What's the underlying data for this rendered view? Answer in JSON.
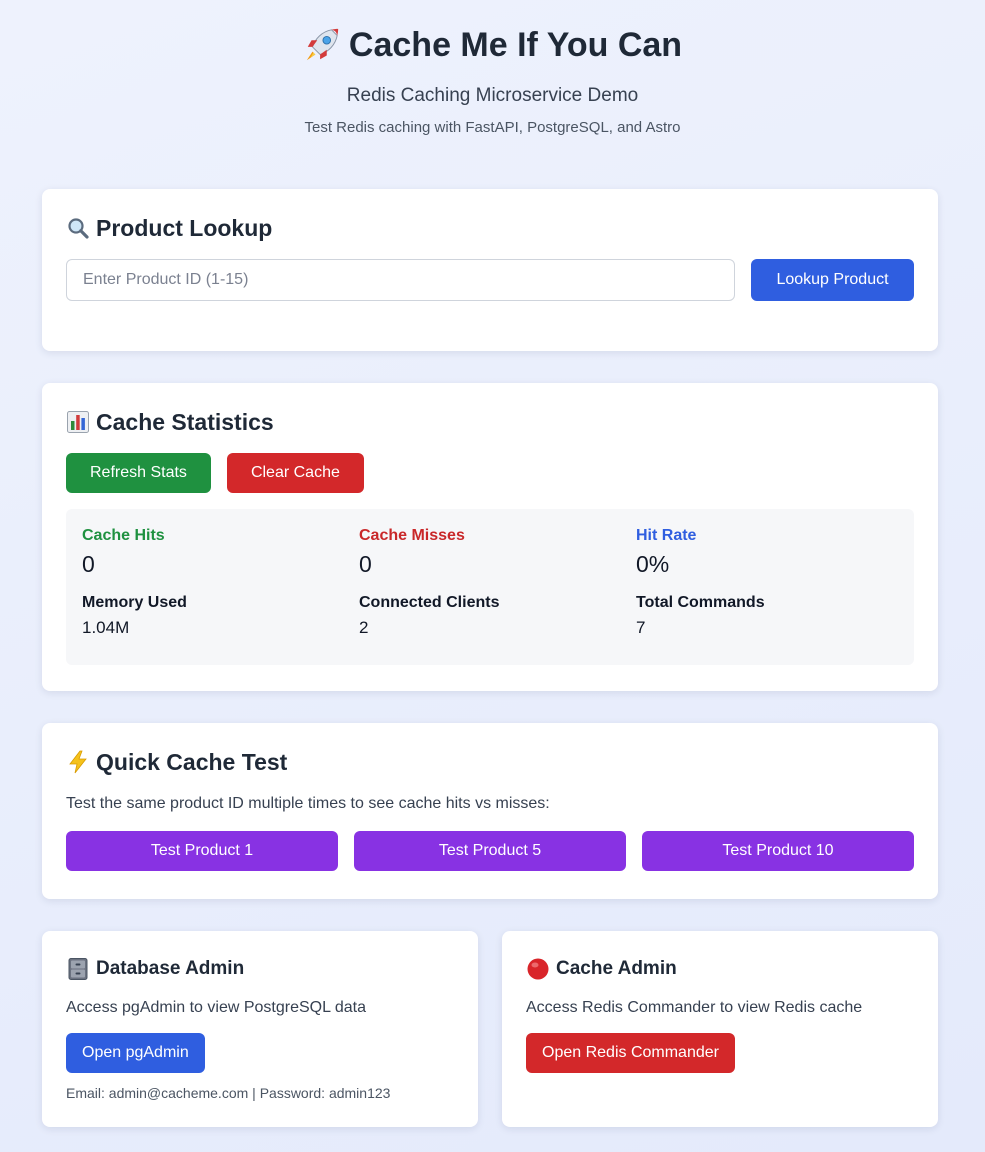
{
  "header": {
    "title": "Cache Me If You Can",
    "subtitle": "Redis Caching Microservice Demo",
    "tagline": "Test Redis caching with FastAPI, PostgreSQL, and Astro",
    "icon": "rocket-icon"
  },
  "lookup": {
    "heading": "Product Lookup",
    "icon": "magnifier-icon",
    "placeholder": "Enter Product ID (1-15)",
    "value": "",
    "button_label": "Lookup Product"
  },
  "stats": {
    "heading": "Cache Statistics",
    "icon": "bar-chart-icon",
    "refresh_label": "Refresh Stats",
    "clear_label": "Clear Cache",
    "hits_label": "Cache Hits",
    "hits_value": "0",
    "misses_label": "Cache Misses",
    "misses_value": "0",
    "hit_rate_label": "Hit Rate",
    "hit_rate_value": "0%",
    "memory_label": "Memory Used",
    "memory_value": "1.04M",
    "clients_label": "Connected Clients",
    "clients_value": "2",
    "commands_label": "Total Commands",
    "commands_value": "7"
  },
  "quick": {
    "heading": "Quick Cache Test",
    "icon": "lightning-icon",
    "description": "Test the same product ID multiple times to see cache hits vs misses:",
    "buttons": [
      "Test Product 1",
      "Test Product 5",
      "Test Product 10"
    ]
  },
  "db_admin": {
    "heading": "Database Admin",
    "icon": "file-cabinet-icon",
    "description": "Access pgAdmin to view PostgreSQL data",
    "button_label": "Open pgAdmin",
    "note": "Email: admin@cacheme.com | Password: admin123"
  },
  "cache_admin": {
    "heading": "Cache Admin",
    "icon": "red-circle-icon",
    "description": "Access Redis Commander to view Redis cache",
    "button_label": "Open Redis Commander"
  },
  "colors": {
    "blue": "#2f5ee0",
    "green": "#1f9140",
    "red": "#d3282a",
    "purple": "#8832e3",
    "hits_text": "#1f9140",
    "misses_text": "#c9282a",
    "hit_rate_text": "#2f5ee0"
  }
}
